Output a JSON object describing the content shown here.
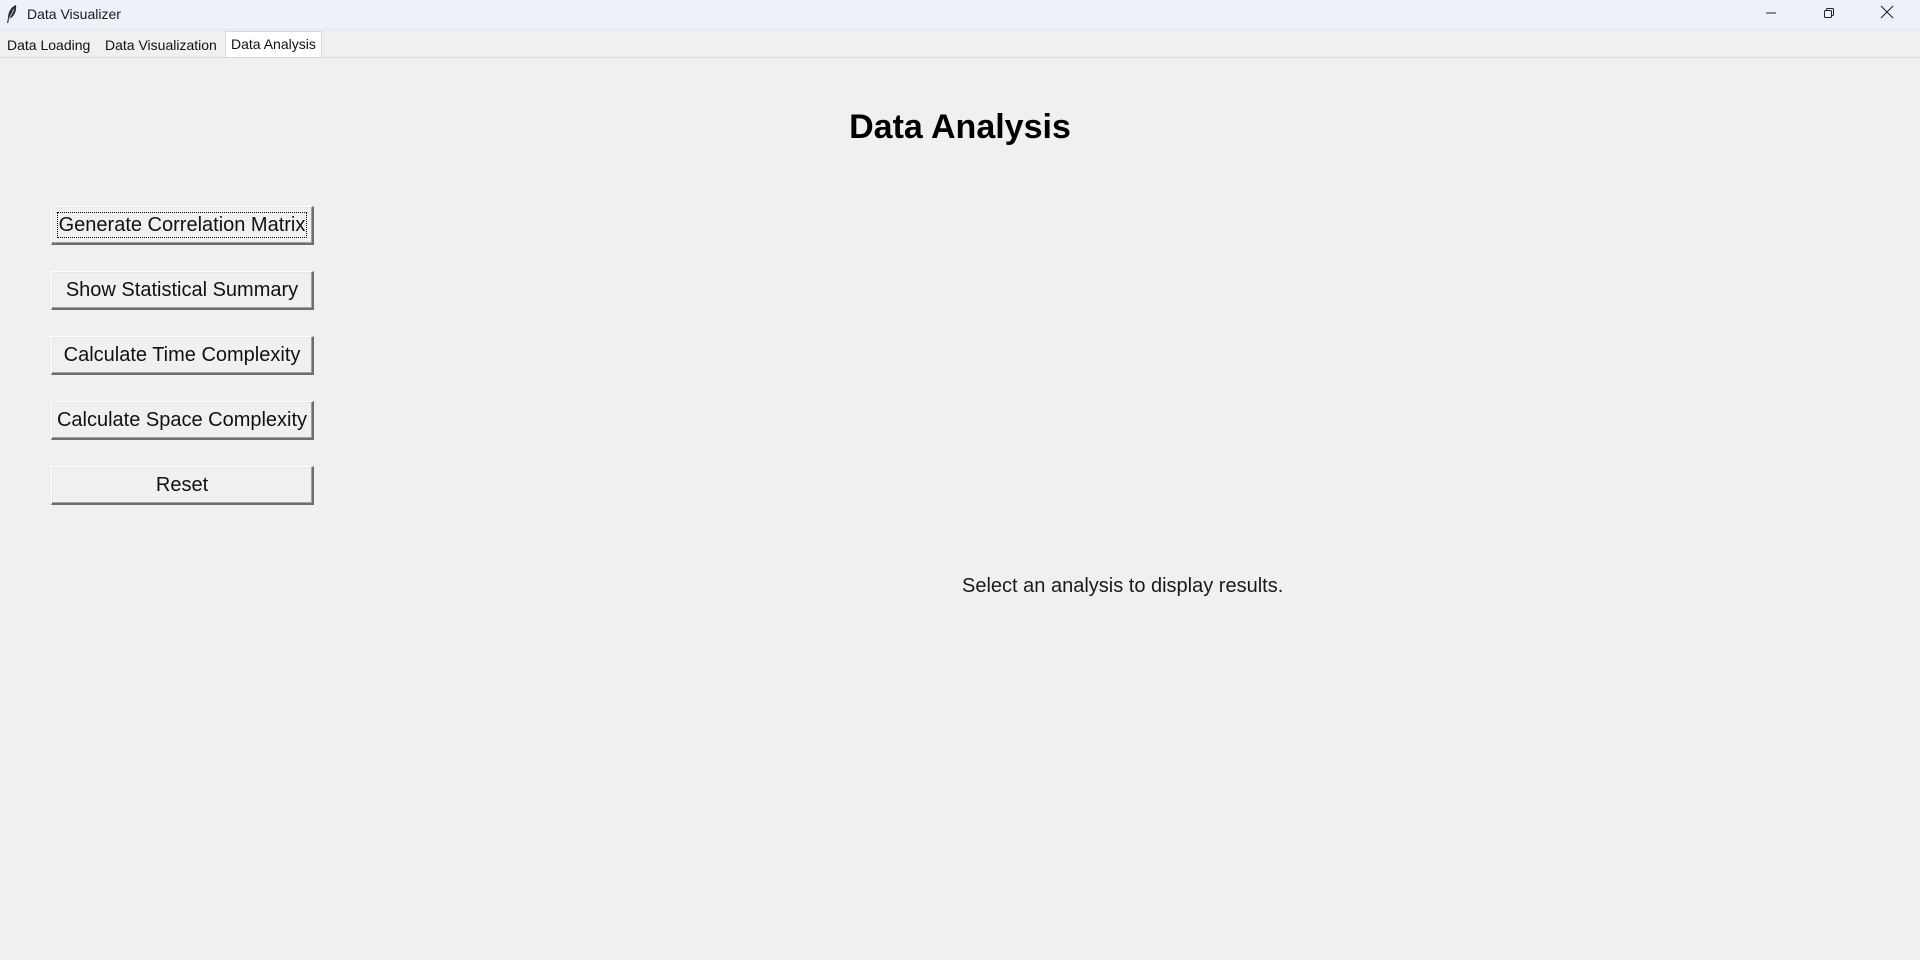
{
  "window": {
    "title": "Data Visualizer",
    "app_icon": "feather-icon",
    "controls": {
      "minimize_icon": "minimize-icon",
      "maximize_icon": "restore-icon",
      "close_icon": "close-icon"
    }
  },
  "tabs": [
    {
      "label": "Data Loading",
      "selected": false
    },
    {
      "label": "Data Visualization",
      "selected": false
    },
    {
      "label": "Data Analysis",
      "selected": true
    }
  ],
  "main": {
    "title": "Data Analysis",
    "buttons": [
      {
        "label": "Generate Correlation Matrix",
        "focused": true
      },
      {
        "label": "Show Statistical Summary",
        "focused": false
      },
      {
        "label": "Calculate Time Complexity",
        "focused": false
      },
      {
        "label": "Calculate Space Complexity",
        "focused": false
      },
      {
        "label": "Reset",
        "focused": false
      }
    ],
    "result_text": "Select an analysis to display results."
  }
}
